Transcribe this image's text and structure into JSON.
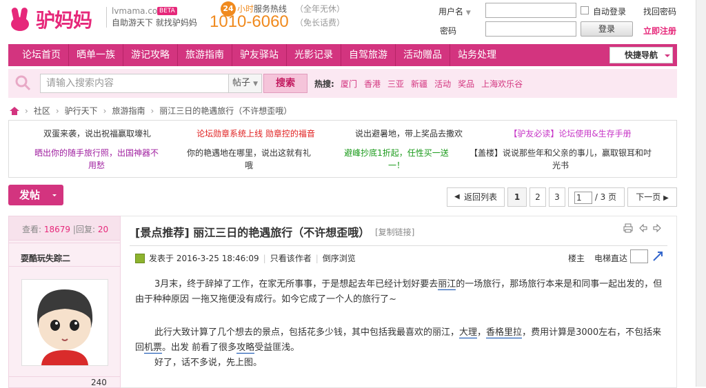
{
  "header": {
    "logo_text": "驴妈妈",
    "site_url": "lvmama.com",
    "beta": "BETA",
    "slogan": "自助游天下  就找驴妈妈",
    "hotline_badge": "24",
    "hotline_label_a": "小时",
    "hotline_label_b": "服务热线",
    "hotline_sub": "（全年无休）",
    "phone": "1010-6060",
    "phone_sub": "（免长话费）",
    "username_label": "用户名",
    "password_label": "密码",
    "auto_login": "自动登录",
    "forgot_password": "找回密码",
    "login_button": "登录",
    "register": "立即注册"
  },
  "nav": {
    "items": [
      "论坛首页",
      "晒单一族",
      "游记攻略",
      "旅游指南",
      "驴友驿站",
      "光影记录",
      "自驾旅游",
      "活动赠品",
      "站务处理"
    ],
    "quick_nav": "快捷导航"
  },
  "search": {
    "placeholder": "请输入搜索内容",
    "type": "帖子",
    "button": "搜索",
    "hot_label": "热搜:",
    "hot_links": [
      "厦门",
      "香港",
      "三亚",
      "新疆",
      "活动",
      "奖品",
      "上海欢乐谷"
    ]
  },
  "breadcrumb": [
    "社区",
    "驴行天下",
    "旅游指南",
    "丽江三日的艳遇旅行（不许想歪哦）"
  ],
  "notices": {
    "r1c1": "双蛋来袭，说出祝福赢取壕礼",
    "r1c2": "论坛勋章系统上线 勋章控的福音",
    "r1c3": "说出避暑地，带上奖品去撒欢",
    "r1c4": "【驴友必读】论坛使用&生存手册",
    "r2c1": "晒出你的随手旅行照，出国神器不用愁",
    "r2c2": "你的艳遇地在哪里，说出这就有礼哦",
    "r2c3": "避峰抄底1折起，任性买一送一！",
    "r2c4": "【盖楼】说说那些年和父亲的事儿，赢取银耳和吋光书"
  },
  "toolbar": {
    "post_button": "发帖",
    "back_to_list": "返回列表",
    "pages": [
      "1",
      "2",
      "3"
    ],
    "page_input": "1",
    "page_total": "/ 3 页",
    "next_page": "下一页"
  },
  "post": {
    "views_label": "查看:",
    "views": "18679",
    "replies_label": "回复:",
    "replies": "20",
    "author": "耍酷玩失踪二",
    "stat_bottom": "240",
    "title": "[景点推荐] 丽江三日的艳遇旅行（不许想歪哦）",
    "copy_link": "[复制链接]",
    "posted_at": "发表于 2016-3-25 18:46:09",
    "only_author": "只看该作者",
    "reverse_view": "倒序浏览",
    "floor": "楼主",
    "elevator": "电梯直达",
    "p1_a": "3月末，终于辞掉了工作，在家无所事事，于是想起去年已经计划好要去",
    "p1_link": "丽江",
    "p1_b": "的一场旅行，那场旅行本来是和同事一起出发的，但由于种种原因 一拖又拖便没有成行。如今它成了一个人的旅行了~",
    "p2_a": "此行大致计算了几个想去的景点，包括花多少钱，其中包括我最喜欢的丽江，",
    "p2_link1": "大理",
    "p2_c1": "，",
    "p2_link2": "香格里拉",
    "p2_b": "，费用计算是3000左右，不包括来回",
    "p2_link3": "机票",
    "p2_c": "。出发 前看了很多",
    "p2_link4": "攻略",
    "p2_d": "受益匪浅。",
    "p3": "好了，话不多说，先上图。"
  }
}
